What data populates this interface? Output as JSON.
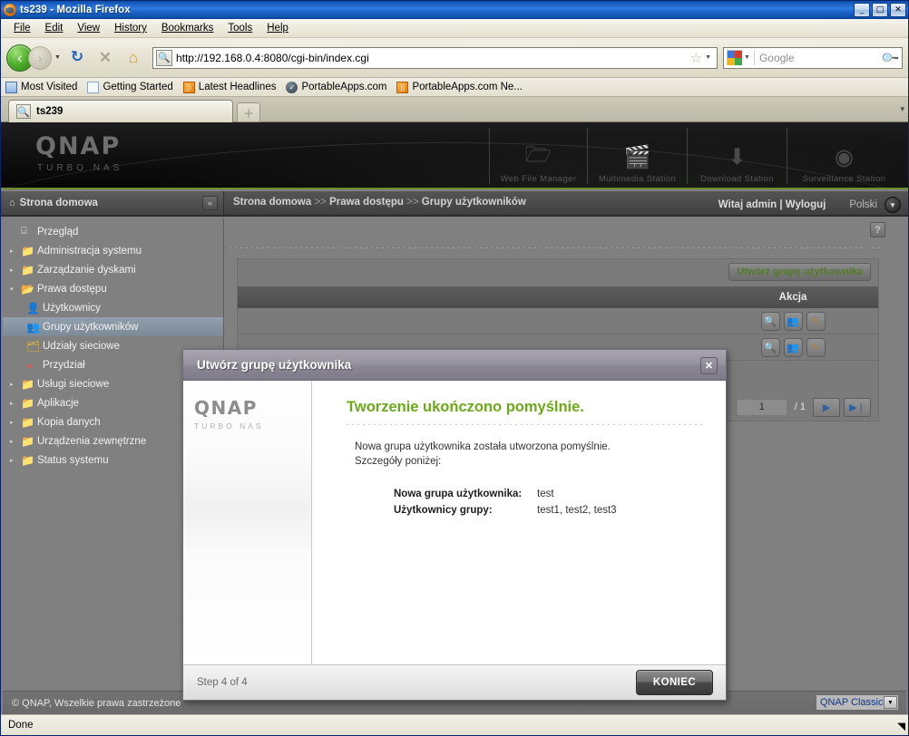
{
  "browser": {
    "window_title": "ts239 - Mozilla Firefox",
    "minimize_label": "_",
    "maximize_label": "□",
    "close_label": "✕",
    "menus": [
      "File",
      "Edit",
      "View",
      "History",
      "Bookmarks",
      "Tools",
      "Help"
    ],
    "nav": {
      "back_icon": "‹",
      "forward_icon": "›",
      "dropdown_icon": "▼",
      "reload_icon": "↻",
      "stop_icon": "✕",
      "home_icon": "⌂",
      "url": "http://192.168.0.4:8080/cgi-bin/index.cgi",
      "site_icon": "🔍",
      "bookmark_star": "☆",
      "url_dropdown": "▼",
      "search_placeholder": "Google",
      "search_engine_dropdown": "▼",
      "search_magnifier": "🔍"
    },
    "bookmarks": [
      {
        "label": "Most Visited",
        "icon": "mostvisited-icon",
        "glyph": "🔍"
      },
      {
        "label": "Getting Started",
        "icon": "page-icon",
        "glyph": ""
      },
      {
        "label": "Latest Headlines",
        "icon": "rss-icon",
        "glyph": "●"
      },
      {
        "label": "PortableApps.com",
        "icon": "portableapps-icon",
        "glyph": "✓"
      },
      {
        "label": "PortableApps.com Ne...",
        "icon": "rss-icon",
        "glyph": "●"
      }
    ],
    "tab": {
      "label": "ts239",
      "favicon": "🔍",
      "new_tab_icon": "＋",
      "tab_list_icon": "▾"
    },
    "status": "Done",
    "resize_grip": "◥"
  },
  "banner": {
    "logo": "QNAP",
    "logo_sub": "TURBO NAS",
    "shortcuts": [
      {
        "label": "Web File Manager",
        "icon": "folder-search-icon",
        "glyph": "🗁"
      },
      {
        "label": "Multimedia Station",
        "icon": "multimedia-icon",
        "glyph": "🎬"
      },
      {
        "label": "Download Station",
        "icon": "download-icon",
        "glyph": "⬇"
      },
      {
        "label": "Surveillance Station",
        "icon": "camera-icon",
        "glyph": "◉"
      }
    ]
  },
  "topbar": {
    "home_tab_label": "Strona domowa",
    "home_icon": "⌂",
    "collapse_icon": "«",
    "breadcrumb": [
      "Strona domowa",
      "Prawa dostępu",
      "Grupy użytkowników"
    ],
    "breadcrumb_separator": ">>",
    "welcome": "Witaj admin | Wyloguj",
    "language": "Polski",
    "language_dropdown_icon": "▼"
  },
  "sidebar": {
    "items": [
      {
        "label": "Przegląd",
        "level": 1,
        "twisty": "",
        "icon": "document-icon",
        "glyph": "⌸",
        "selected": false
      },
      {
        "label": "Administracja systemu",
        "level": 1,
        "twisty": "▸",
        "icon": "folder-icon",
        "glyph": "📁",
        "selected": false
      },
      {
        "label": "Zarządzanie dyskami",
        "level": 1,
        "twisty": "▸",
        "icon": "folder-icon",
        "glyph": "📁",
        "selected": false
      },
      {
        "label": "Prawa dostępu",
        "level": 1,
        "twisty": "▾",
        "icon": "folder-open-icon",
        "glyph": "📂",
        "selected": false
      },
      {
        "label": "Użytkownicy",
        "level": 2,
        "twisty": "",
        "icon": "user-icon",
        "glyph": "👤",
        "selected": false
      },
      {
        "label": "Grupy użytkowników",
        "level": 2,
        "twisty": "",
        "icon": "group-icon",
        "glyph": "👥",
        "selected": true
      },
      {
        "label": "Udziały sieciowe",
        "level": 2,
        "twisty": "",
        "icon": "share-folder-icon",
        "glyph": "🗂",
        "selected": false
      },
      {
        "label": "Przydział",
        "level": 2,
        "twisty": "",
        "icon": "quota-icon",
        "glyph": "◕",
        "selected": false
      },
      {
        "label": "Usługi sieciowe",
        "level": 1,
        "twisty": "▸",
        "icon": "folder-icon",
        "glyph": "📁",
        "selected": false
      },
      {
        "label": "Aplikacje",
        "level": 1,
        "twisty": "▸",
        "icon": "folder-icon",
        "glyph": "📁",
        "selected": false
      },
      {
        "label": "Kopia danych",
        "level": 1,
        "twisty": "▸",
        "icon": "folder-icon",
        "glyph": "📁",
        "selected": false
      },
      {
        "label": "Urządzenia zewnętrzne",
        "level": 1,
        "twisty": "▸",
        "icon": "folder-icon",
        "glyph": "📁",
        "selected": false
      },
      {
        "label": "Status systemu",
        "level": 1,
        "twisty": "▸",
        "icon": "folder-icon",
        "glyph": "📁",
        "selected": false
      }
    ]
  },
  "content": {
    "help_icon": "?",
    "create_group_button": "Utwórz grupę użytkownika",
    "table": {
      "action_header": "Akcja",
      "row_actions": [
        {
          "view_icon": "🔍",
          "members_icon": "👥",
          "edit_icon": "✎"
        },
        {
          "view_icon": "🔍",
          "members_icon": "👥",
          "edit_icon": "✎"
        }
      ]
    },
    "pager": {
      "current_page": "1",
      "total": "/ 1",
      "next_icon": "▶",
      "last_icon": "▶❘"
    }
  },
  "page_footer": {
    "copyright": "© QNAP, Wszelkie prawa zastrzeżone",
    "skin_selected": "QNAP Classic",
    "skin_dropdown_icon": "▼"
  },
  "dialog": {
    "title": "Utwórz grupę użytkownika",
    "close_icon": "✕",
    "logo": "QNAP",
    "logo_sub": "TURBO NAS",
    "success_title": "Tworzenie ukończono pomyślnie.",
    "paragraph_line1": "Nowa grupa użytkownika została utworzona pomyślnie.",
    "paragraph_line2": "Szczegóły poniżej:",
    "details": [
      {
        "key": "Nowa grupa użytkownika:",
        "value": "test"
      },
      {
        "key": "Użytkownicy grupy:",
        "value": "test1, test2, test3"
      }
    ],
    "step": "Step 4 of 4",
    "finish_button": "KONIEC"
  },
  "colors": {
    "accent_green": "#6aaa19",
    "banner_green": "#6e8c2b",
    "link_blue": "#0d3a8c",
    "titlebar_blue": "#1557b8"
  }
}
